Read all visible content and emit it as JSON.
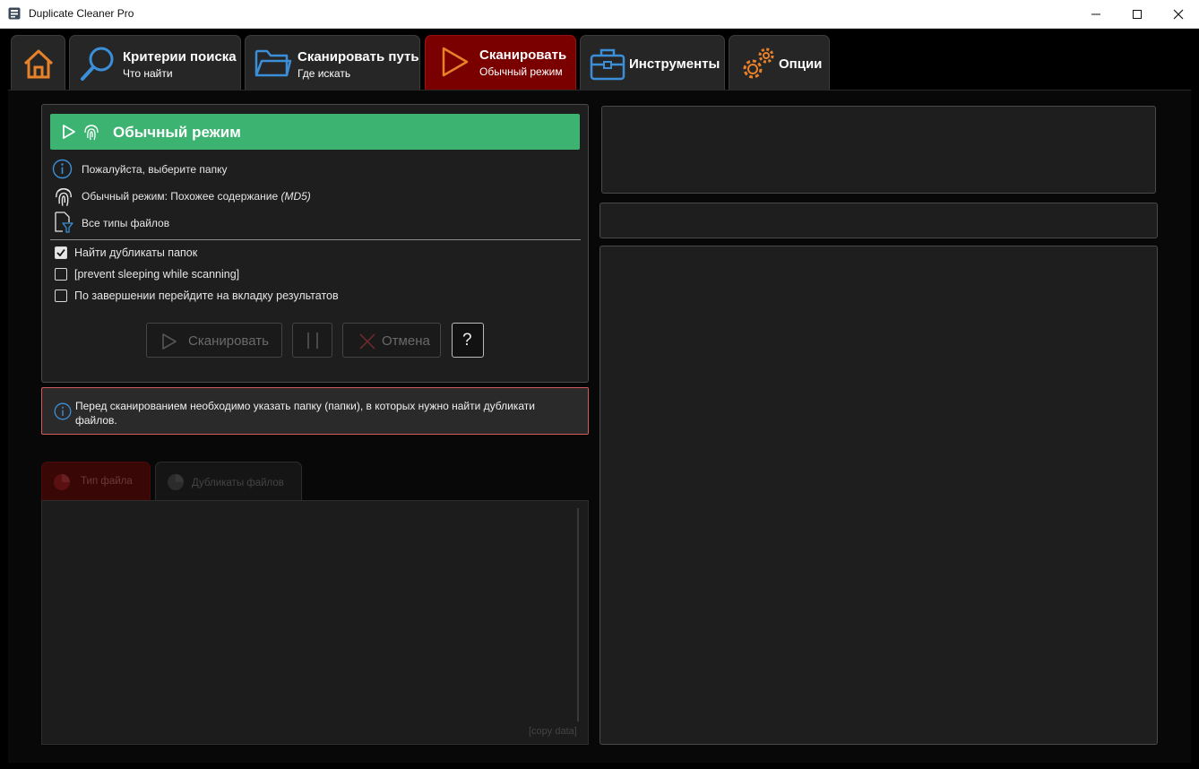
{
  "window": {
    "title": "Duplicate Cleaner Pro"
  },
  "tabs": {
    "home": {
      "icon": "home-icon"
    },
    "criteria": {
      "title": "Критерии поиска",
      "subtitle": "Что найти",
      "icon": "search-icon"
    },
    "scan_path": {
      "title": "Сканировать путь",
      "subtitle": "Где искать",
      "icon": "folder-icon"
    },
    "scan": {
      "title": "Сканировать",
      "subtitle": "Обычный режим",
      "icon": "play-icon"
    },
    "tools": {
      "title": "Инструменты",
      "icon": "toolbox-icon"
    },
    "options": {
      "title": "Опции",
      "icon": "gear-icon"
    }
  },
  "scan_panel": {
    "mode_title": "Обычный режим",
    "info": {
      "folder": "Пожалуйста, выберите папку",
      "mode": "Обычный режим: Похожее содержание",
      "mode_hash": "(MD5)",
      "file_types": "Все типы файлов"
    },
    "options": {
      "find_folder_duplicates": {
        "label": "Найти дубликаты папок",
        "checked": true
      },
      "prevent_sleep": {
        "label": "[prevent sleeping while scanning]",
        "checked": false
      },
      "goto_results": {
        "label": "По завершении перейдите на вкладку результатов",
        "checked": false
      }
    },
    "buttons": {
      "scan": "Сканировать",
      "cancel": "Отмена",
      "help": "?"
    }
  },
  "warning": {
    "text": "Перед сканированием необходимо указать папку (папки), в которых нужно найти дубликати файлов."
  },
  "stats_tabs": {
    "file_type": "Тип файла",
    "duplicates": "Дубликаты файлов"
  },
  "copy_data_label": "[copy data]",
  "colors": {
    "accent_green": "#3cb371",
    "active_tab": "#7a0000",
    "warning_border": "#d25a5a",
    "icon_blue": "#3b8fd8",
    "icon_orange": "#e8822a"
  }
}
